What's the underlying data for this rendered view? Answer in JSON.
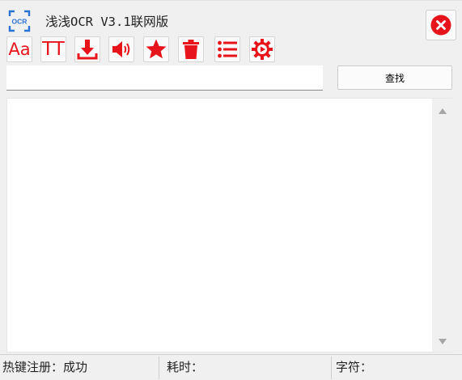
{
  "window": {
    "title": "浅浅OCR V3.1联网版",
    "logo_text": "OCR",
    "accent_color": "#e8141b",
    "logo_color": "#2a73d6"
  },
  "toolbar": {
    "buttons": [
      {
        "id": "font",
        "text": "Aa",
        "icon": "font-size-icon"
      },
      {
        "id": "style",
        "text": "TT",
        "icon": "text-style-icon"
      },
      {
        "id": "download",
        "icon": "download-icon"
      },
      {
        "id": "speak",
        "icon": "speaker-icon"
      },
      {
        "id": "favorite",
        "icon": "star-icon"
      },
      {
        "id": "clear",
        "icon": "trash-icon"
      },
      {
        "id": "list",
        "icon": "list-icon"
      },
      {
        "id": "settings",
        "icon": "gear-icon"
      }
    ]
  },
  "search": {
    "value": "",
    "button_label": "查找"
  },
  "result": {
    "text": ""
  },
  "status": {
    "hotkey": "热键注册：成功",
    "time": "耗时：",
    "chars": "字符："
  }
}
